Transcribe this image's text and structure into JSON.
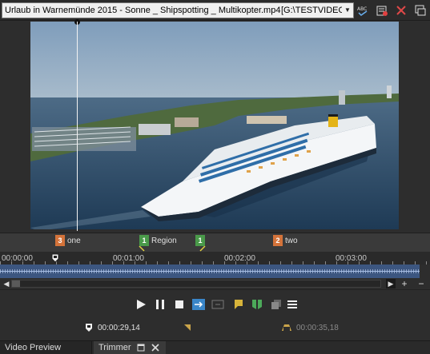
{
  "topbar": {
    "file_name": "Urlaub in Warnemünde 2015 - Sonne _ Shipspotting _ Multikopter.mp4",
    "drive_path": "[G:\\TESTVIDEO",
    "icons": [
      "spellcheck-icon",
      "tag-icon",
      "delete-x-icon",
      "window-icon"
    ]
  },
  "markers": [
    {
      "number": "3",
      "label": "one",
      "color": "#d4733a"
    },
    {
      "number": "1",
      "label": "Region",
      "color": "#4a9a4a"
    },
    {
      "number": "1",
      "label": "",
      "color": "#4a9a4a"
    },
    {
      "number": "2",
      "label": "two",
      "color": "#d4733a"
    }
  ],
  "ruler": {
    "labels": [
      "00:00:00",
      "00:01:00",
      "00:02:00",
      "00:03:00"
    ]
  },
  "scrollbar": {
    "plus": "+",
    "minus": "−"
  },
  "transport": {
    "buttons": [
      "play",
      "pause",
      "stop",
      "loop",
      "selection",
      "add-marker",
      "add-region",
      "snapshot",
      "menu"
    ]
  },
  "timecodes": {
    "in_point": "00:00:29,14",
    "out_point": "00:00:35,18"
  },
  "tabs": {
    "video_preview": "Video Preview",
    "trimmer": "Trimmer"
  }
}
